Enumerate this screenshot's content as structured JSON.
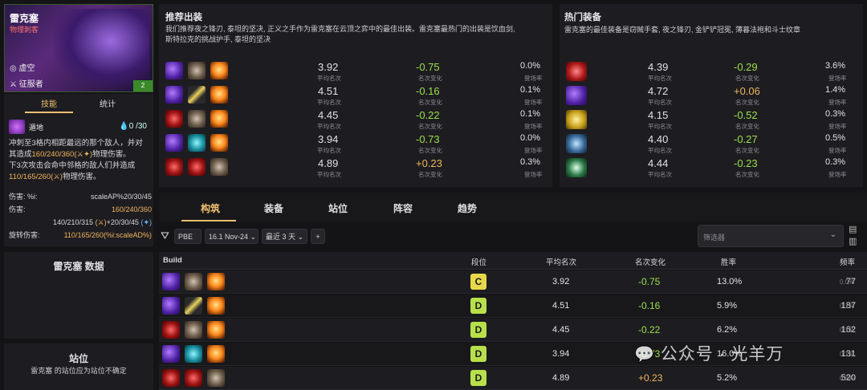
{
  "champion": {
    "name": "雷克塞",
    "role": "物理刺客",
    "trait1": "虚空",
    "trait2": "征服者",
    "cost_badge": "2"
  },
  "tabs_left": [
    "技能",
    "统计"
  ],
  "skill": {
    "name": "遁地",
    "mana": "0 /30",
    "desc1": "冲刺至3格内相距最远的那个敌人，并对",
    "desc2a": "其造成",
    "desc2b": "160/240/360",
    "desc2c": "物理伤害。",
    "desc3": "下3次攻击会命中邻格的敌人们并造成",
    "desc4a": "110/165/260",
    "desc4b": "物理伤害。",
    "stat1_label": "伤害:",
    "stat1_a": "%i:",
    "stat1_b": "scaleAP%20/30/45",
    "stat2_label": "伤害:",
    "stat2_b": "160/240/360",
    "stat3": "140/210/315",
    "stat3b": "+20/30/45",
    "stat4_label": "旋转伤害:",
    "stat4_b": "110/165/260(%i:scaleAD%)"
  },
  "champ_data_title": "雷克塞 数据",
  "position": {
    "title": "站位",
    "desc": "雷克塞 的站位应为站位不确定"
  },
  "recommended": {
    "title": "推荐出装",
    "desc1": "我们推荐夜之锋刃, 泰坦的坚决, 正义之手作为雷克塞在云顶之弈中的最佳出装。雷克塞最热门的出装是饮血剑,",
    "desc2": "斯特拉克的挑战护手, 泰坦的坚决",
    "rows": [
      {
        "icons": [
          "purple",
          "claw",
          "fire"
        ],
        "avg": "3.92",
        "change": "-0.75",
        "rate": "0.0%"
      },
      {
        "icons": [
          "purple",
          "blade",
          "fire"
        ],
        "avg": "4.51",
        "change": "-0.16",
        "rate": "0.1%"
      },
      {
        "icons": [
          "red",
          "claw",
          "fire"
        ],
        "avg": "4.45",
        "change": "-0.22",
        "rate": "0.1%"
      },
      {
        "icons": [
          "purple",
          "teal",
          "fire"
        ],
        "avg": "3.94",
        "change": "-0.73",
        "rate": "0.0%"
      },
      {
        "icons": [
          "red",
          "red",
          "claw"
        ],
        "avg": "4.89",
        "change": "+0.23",
        "rate": "0.3%"
      }
    ],
    "sub_avg": "平均名次",
    "sub_change": "名次变化",
    "sub_rate": "登场率"
  },
  "hot": {
    "title": "热门装备",
    "desc": "雷克塞的最佳装备是窃贼手套, 夜之锋刃, 金铲铲冠冕, 薄暮法袍和斗士纹章",
    "rows": [
      {
        "icon": "mask",
        "avg": "4.39",
        "change": "-0.29",
        "rate": "3.6%"
      },
      {
        "icon": "purple",
        "avg": "4.72",
        "change": "+0.06",
        "rate": "1.4%"
      },
      {
        "icon": "gold",
        "avg": "4.15",
        "change": "-0.52",
        "rate": "0.3%"
      },
      {
        "icon": "orb",
        "avg": "4.40",
        "change": "-0.27",
        "rate": "0.5%"
      },
      {
        "icon": "green",
        "avg": "4.44",
        "change": "-0.23",
        "rate": "0.3%"
      }
    ]
  },
  "main_tabs": [
    "构筑",
    "装备",
    "站位",
    "阵容",
    "趋势"
  ],
  "filters": {
    "rank": "PBE",
    "version": "16.1 Nov-24",
    "time": "最近 3 天",
    "plus": "+",
    "placeholder": "筛选器"
  },
  "table": {
    "headers": [
      "Build",
      "段位",
      "平均名次",
      "名次变化",
      "胜率",
      "频率"
    ],
    "rows": [
      {
        "icons": [
          "purple",
          "claw",
          "fire"
        ],
        "tier": "C",
        "avg": "3.92",
        "change": "-0.75",
        "win": "13.0%",
        "freq": "77",
        "freq_pct": "0.0%"
      },
      {
        "icons": [
          "purple",
          "blade",
          "fire"
        ],
        "tier": "D",
        "avg": "4.51",
        "change": "-0.16",
        "win": "5.9%",
        "freq": "187",
        "freq_pct": "0.1%"
      },
      {
        "icons": [
          "red",
          "claw",
          "fire"
        ],
        "tier": "D",
        "avg": "4.45",
        "change": "-0.22",
        "win": "6.2%",
        "freq": "162",
        "freq_pct": "0.1%"
      },
      {
        "icons": [
          "purple",
          "teal",
          "fire"
        ],
        "tier": "D",
        "avg": "3.94",
        "change": "-0.73",
        "win": "16.0%",
        "freq": "131",
        "freq_pct": "0.1%"
      },
      {
        "icons": [
          "red",
          "red",
          "claw"
        ],
        "tier": "D",
        "avg": "4.89",
        "change": "+0.23",
        "win": "5.2%",
        "freq": "520",
        "freq_pct": "0.3%"
      }
    ]
  },
  "watermark": "公众号 · 光羊万",
  "colors": {
    "tier_C": "#e8d84a",
    "tier_D": "#b8e04a",
    "accent": "#f0b45c",
    "negative": "#9be04a"
  }
}
